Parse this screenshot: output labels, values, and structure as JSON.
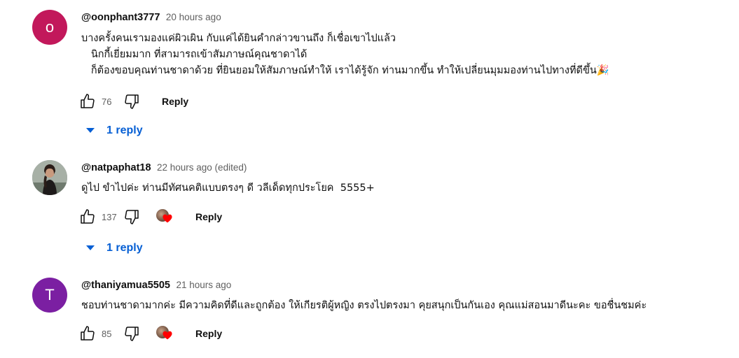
{
  "comments": [
    {
      "handle": "@oonphant3777",
      "time": "20 hours ago",
      "avatar_letter": "o",
      "avatar_color": "#c2185b",
      "lines": [
        "บางครั้งคนเรามองแค่ผิวเผิน กับแค่ได้ยินคำกล่าวขานถึง ก็เชื่อเขาไปแล้ว",
        "   นิกกี้เยี่ยมมาก ที่สามารถเข้าสัมภาษณ์คุณชาดาได้",
        "   ก็ต้องขอบคุณท่านชาดาด้วย ที่ยินยอมให้สัมภาษณ์ทำให้ เราได้รู้จัก ท่านมากขึ้น ทำให้เปลี่ยนมุมมองท่านไปทางที่ดีขึ้น🎉"
      ],
      "likes": "76",
      "reply_label": "Reply",
      "replies_label": "1 reply"
    },
    {
      "handle": "@natpaphat18",
      "time": "22 hours ago (edited)",
      "lines": [
        "ดูไป ขำไปค่ะ ท่านมีทัศนคติแบบตรงๆ ดี วลีเด็ดทุกประโยค  5555+"
      ],
      "likes": "137",
      "reply_label": "Reply",
      "replies_label": "1 reply"
    },
    {
      "handle": "@thaniyamua5505",
      "time": "21 hours ago",
      "avatar_letter": "T",
      "avatar_color": "#7b1fa2",
      "lines": [
        "ชอบท่านชาดามากค่ะ มีความคิดที่ดีและถูกต้อง ให้เกียรติผู้หญิง ตรงไปตรงมา คุยสนุกเป็นกันเอง คุณแม่สอนมาดีนะคะ ขอชื่นชมค่ะ"
      ],
      "likes": "85",
      "reply_label": "Reply"
    }
  ],
  "icons": {
    "like": "thumbs-up-icon",
    "dislike": "thumbs-down-icon",
    "expand": "caret-down-icon",
    "heart": "creator-heart-icon"
  },
  "colors": {
    "link_blue": "#065fd4",
    "meta_gray": "#606060",
    "heart_red": "#ff0000"
  }
}
